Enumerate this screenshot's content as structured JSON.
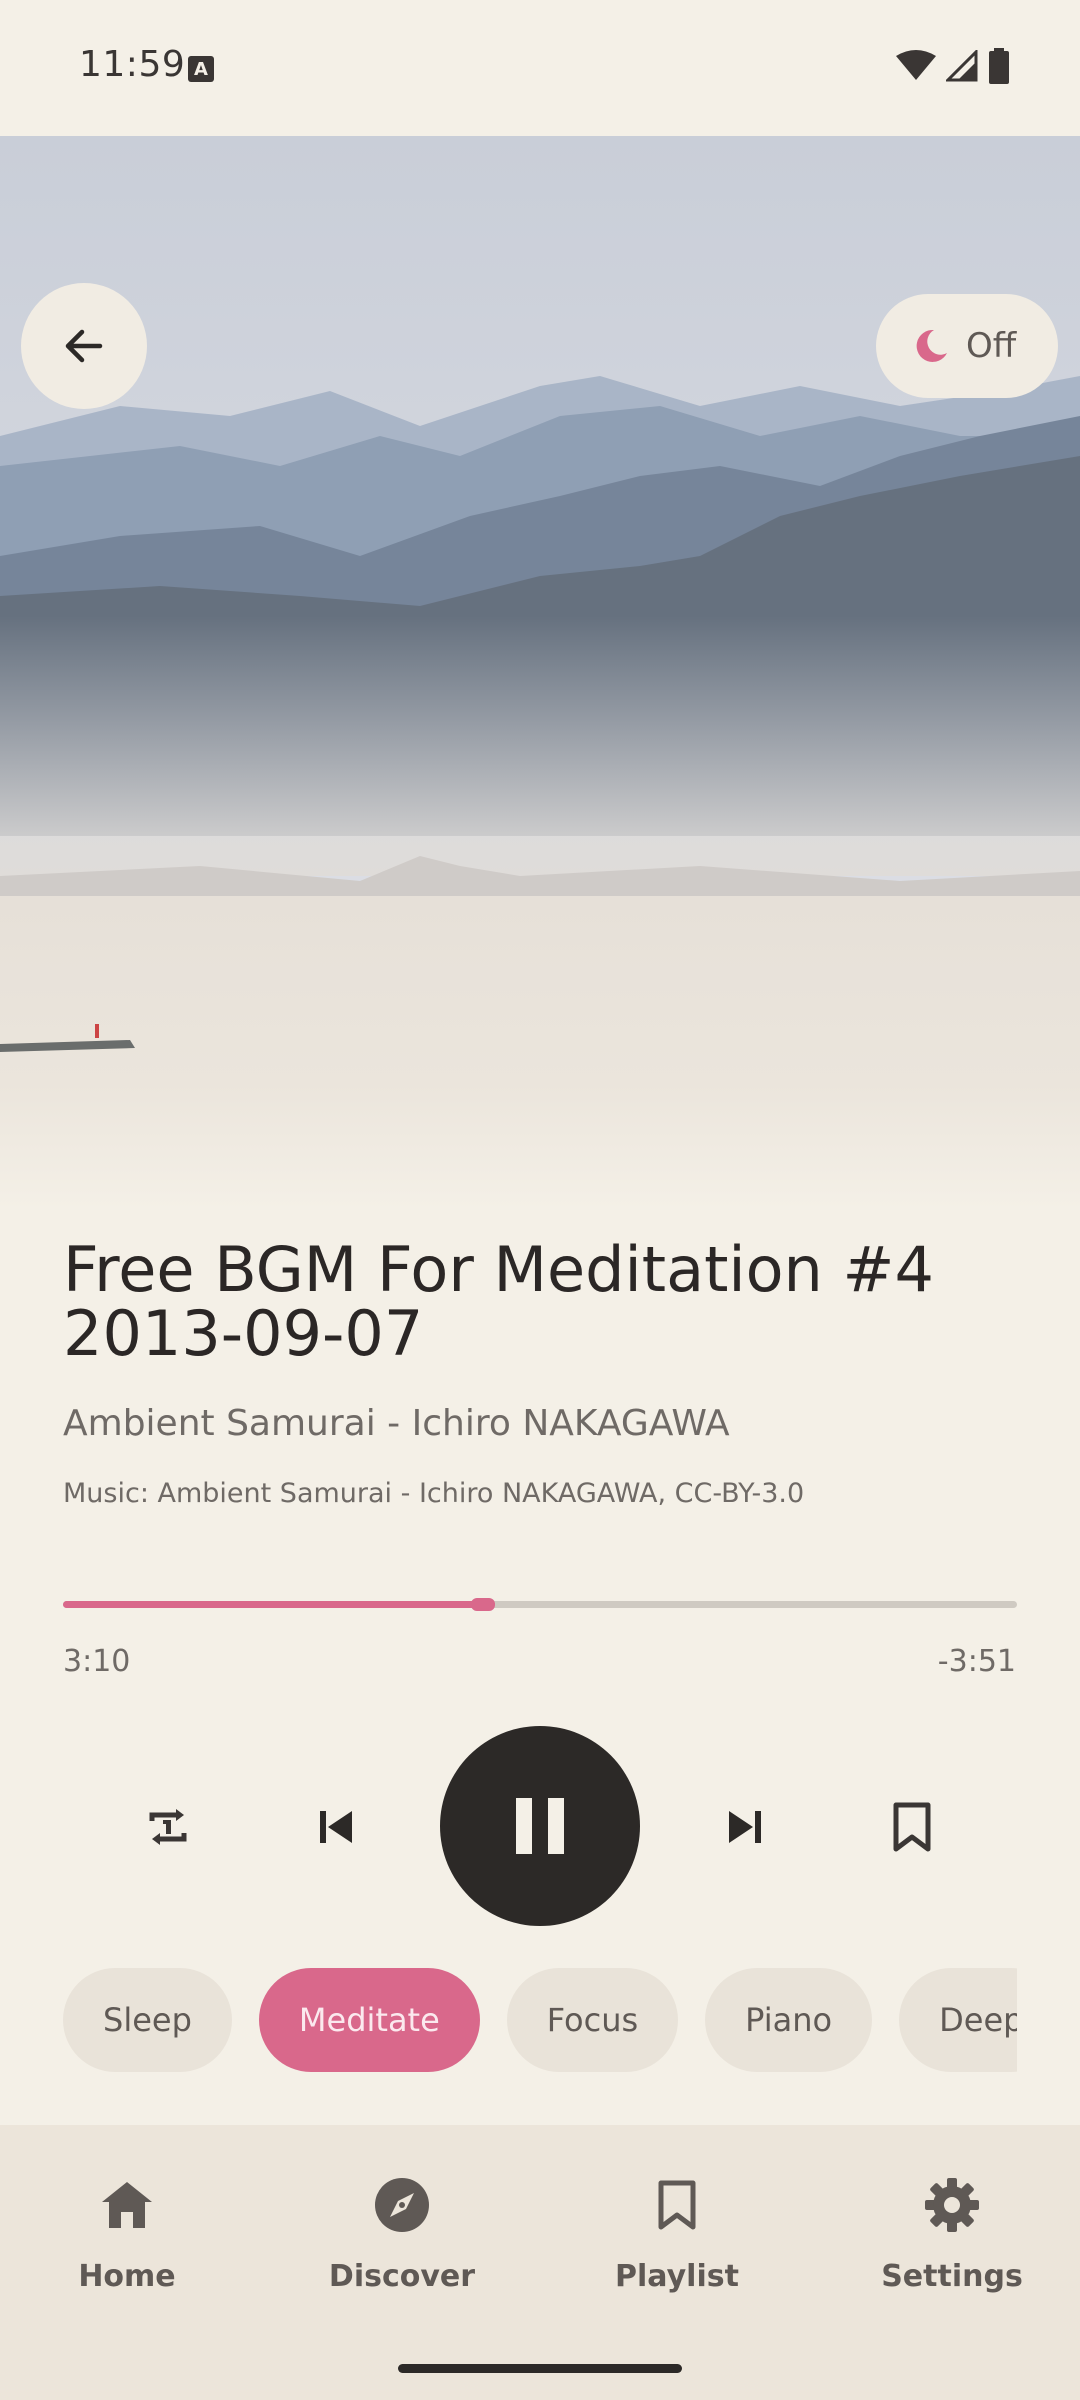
{
  "status_bar": {
    "time": "11:59",
    "keyboard_indicator": "A"
  },
  "hero": {
    "image_description_icon": "landscape-image",
    "back_icon": "arrow-left-icon",
    "sleep_timer": {
      "icon": "moon-icon",
      "label": "Off"
    }
  },
  "track": {
    "title": "Free BGM For Meditation #4 2013-09-07",
    "artist": "Ambient Samurai - Ichiro NAKAGAWA",
    "credit": "Music: Ambient Samurai - Ichiro NAKAGAWA, CC-BY-3.0"
  },
  "progress": {
    "elapsed": "3:10",
    "remaining": "-3:51",
    "fraction": 0.44
  },
  "controls": {
    "repeat_icon": "repeat-icon",
    "previous_icon": "skip-previous-icon",
    "play_state_icon": "pause-icon",
    "next_icon": "skip-next-icon",
    "bookmark_icon": "bookmark-icon"
  },
  "chips": [
    {
      "label": "Sleep",
      "active": false
    },
    {
      "label": "Meditate",
      "active": true
    },
    {
      "label": "Focus",
      "active": false
    },
    {
      "label": "Piano",
      "active": false
    },
    {
      "label": "Deep",
      "active": false
    }
  ],
  "nav": {
    "items": [
      {
        "label": "Home",
        "icon": "home-icon"
      },
      {
        "label": "Discover",
        "icon": "compass-icon"
      },
      {
        "label": "Playlist",
        "icon": "bookmark-icon"
      },
      {
        "label": "Settings",
        "icon": "gear-icon"
      }
    ]
  },
  "colors": {
    "accent": "#d9688b",
    "background": "#f4f0e7",
    "dark": "#2c2927",
    "nav_background": "#ece5da"
  }
}
